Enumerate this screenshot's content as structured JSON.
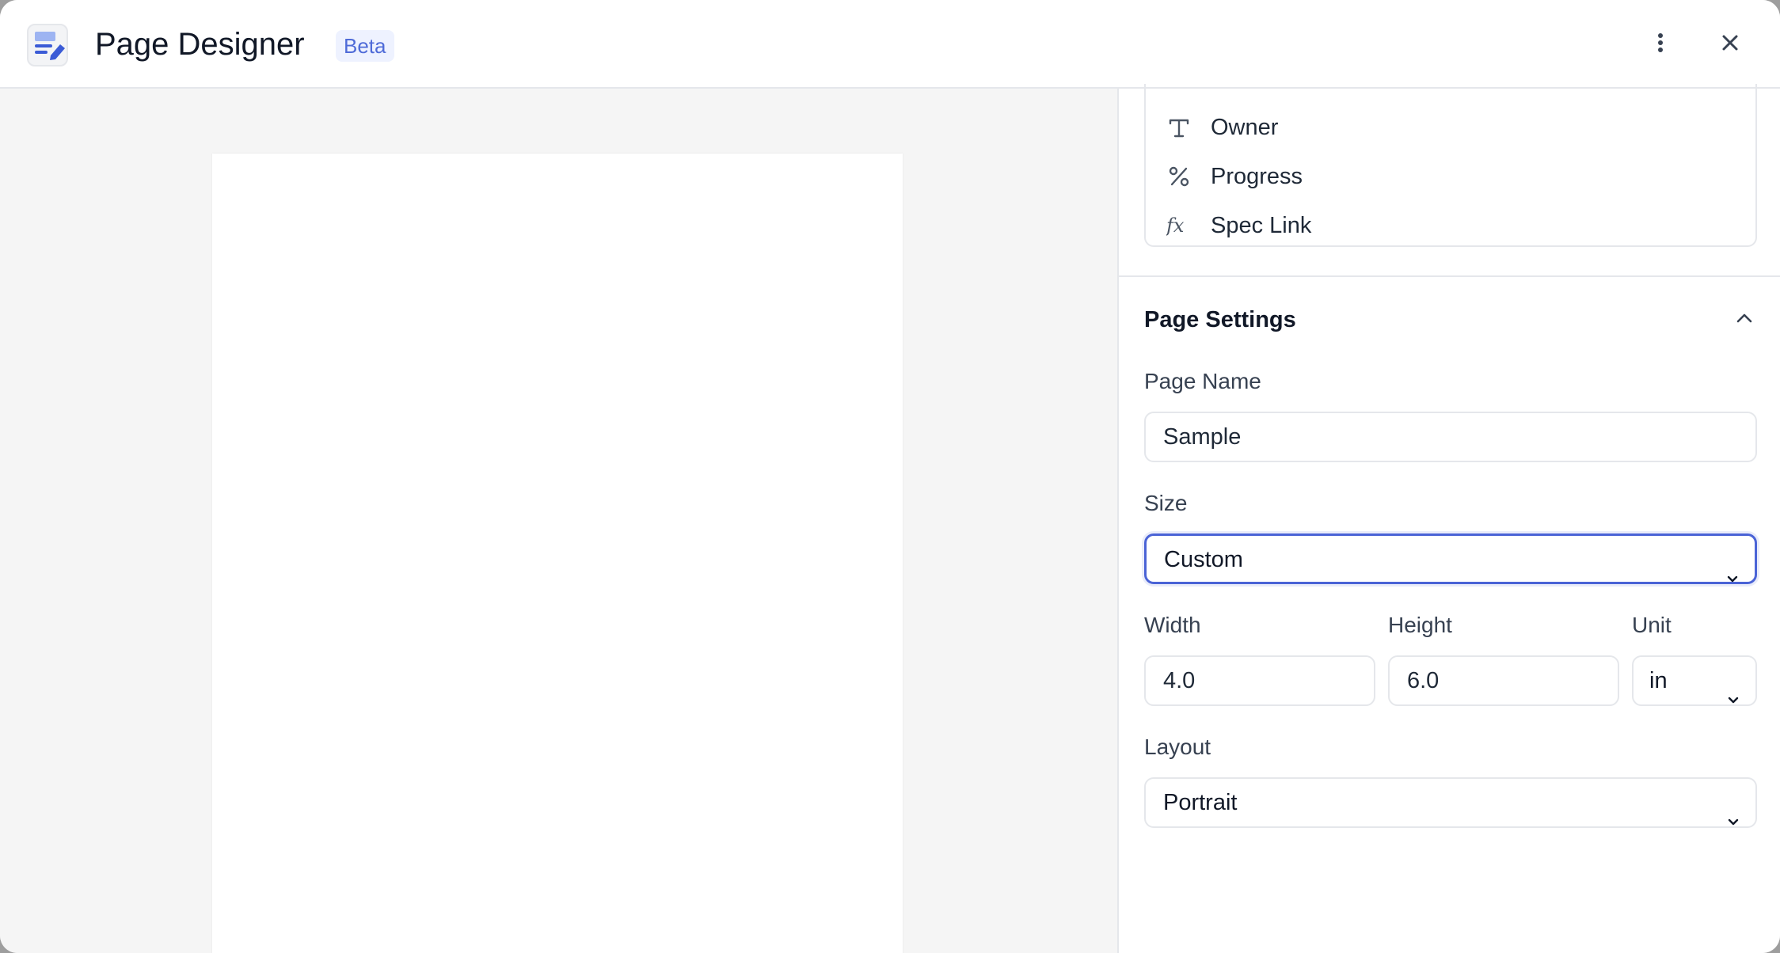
{
  "header": {
    "app_icon": "page-designer-icon",
    "title": "Page Designer",
    "badge": "Beta",
    "more_icon": "more-vertical-icon",
    "close_icon": "close-icon"
  },
  "fields": [
    {
      "icon": "text-type-icon",
      "glyph": "T",
      "label": "Owner"
    },
    {
      "icon": "percent-icon",
      "glyph": "%",
      "label": "Progress"
    },
    {
      "icon": "formula-icon",
      "glyph": "fx",
      "label": "Spec Link"
    }
  ],
  "page_settings": {
    "title": "Page Settings",
    "page_name": {
      "label": "Page Name",
      "value": "Sample"
    },
    "size": {
      "label": "Size",
      "value": "Custom"
    },
    "width": {
      "label": "Width",
      "value": "4.0"
    },
    "height": {
      "label": "Height",
      "value": "6.0"
    },
    "unit": {
      "label": "Unit",
      "value": "in"
    },
    "layout": {
      "label": "Layout",
      "value": "Portrait"
    }
  },
  "colors": {
    "accent": "#4a63d6",
    "badge_bg": "#eef2ff",
    "canvas_bg": "#f5f5f5"
  }
}
